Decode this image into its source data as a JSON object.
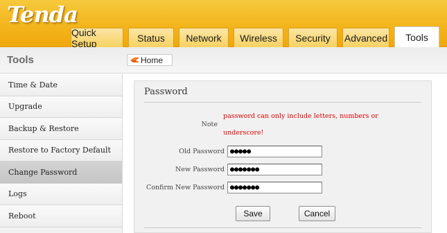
{
  "brand": {
    "logo_text": "Tenda"
  },
  "tabs": [
    {
      "label": "Quick Setup",
      "active": false
    },
    {
      "label": "Status",
      "active": false
    },
    {
      "label": "Network",
      "active": false
    },
    {
      "label": "Wireless",
      "active": false
    },
    {
      "label": "Security",
      "active": false
    },
    {
      "label": "Advanced",
      "active": false
    },
    {
      "label": "Tools",
      "active": true
    }
  ],
  "section": {
    "heading": "Tools"
  },
  "breadcrumb": {
    "home_label": "Home",
    "icon": "home-icon"
  },
  "sidebar": {
    "items": [
      {
        "label": "Time & Date",
        "selected": false
      },
      {
        "label": "Upgrade",
        "selected": false
      },
      {
        "label": "Backup & Restore",
        "selected": false
      },
      {
        "label": "Restore to Factory Default",
        "selected": false
      },
      {
        "label": "Change Password",
        "selected": true
      },
      {
        "label": "Logs",
        "selected": false
      },
      {
        "label": "Reboot",
        "selected": false
      }
    ]
  },
  "panel": {
    "title": "Password",
    "note_label": "Note",
    "note_line1": "password can only include letters, numbers or",
    "note_line2": "underscore!",
    "old_password_label": "Old Password",
    "old_password_value": "●●●●●",
    "new_password_label": "New Password",
    "new_password_value": "●●●●●●●",
    "confirm_password_label": "Confirm New Password",
    "confirm_password_value": "●●●●●●●",
    "save_label": "Save",
    "cancel_label": "Cancel"
  },
  "colors": {
    "header_gold": "#f3b51c",
    "warning_red": "#e00000",
    "panel_bg": "#f1f1f1"
  }
}
